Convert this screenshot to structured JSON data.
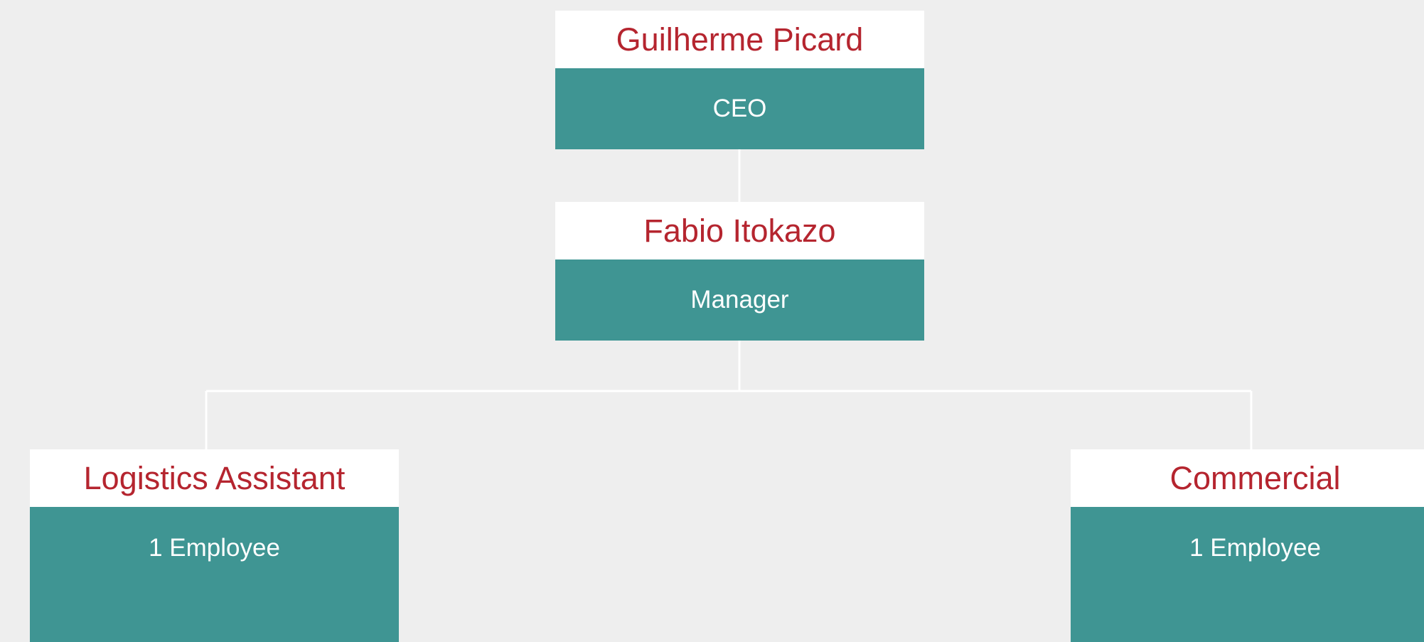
{
  "org_chart": {
    "nodes": [
      {
        "id": "ceo",
        "name": "Guilherme Picard",
        "role": "CEO"
      },
      {
        "id": "manager",
        "name": "Fabio Itokazo",
        "role": "Manager"
      },
      {
        "id": "logistics",
        "name": "Logistics Assistant",
        "role": "1 Employee"
      },
      {
        "id": "commercial",
        "name": "Commercial",
        "role": "1 Employee"
      }
    ],
    "links": [
      {
        "from": "ceo",
        "to": "manager"
      },
      {
        "from": "manager",
        "to": "logistics"
      },
      {
        "from": "manager",
        "to": "commercial"
      }
    ]
  },
  "colors": {
    "background": "#eeeeee",
    "name_text": "#b5252f",
    "role_band": "#3f9593",
    "role_text": "#ffffff",
    "connector": "#ffffff"
  }
}
